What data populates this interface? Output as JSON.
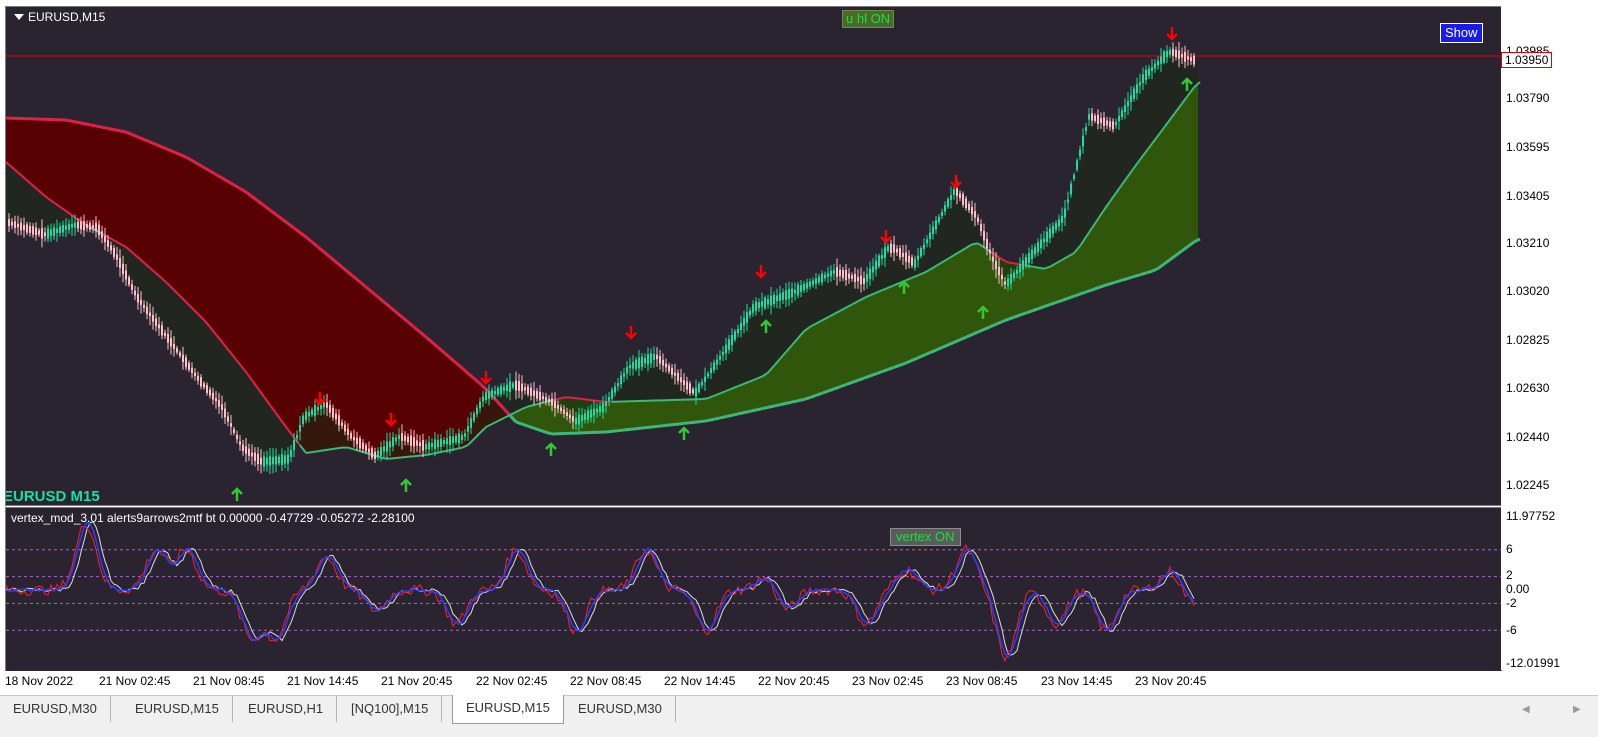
{
  "main_chart": {
    "title": "EURUSD,M15",
    "hl_button": "u hl ON",
    "show_button": "Show",
    "symbol_label": "EURUSD M15"
  },
  "sub_chart": {
    "title": "vertex_mod_3.01 alerts9arrows2mtf bt 0.00000 -0.47729 -0.05272 -2.28100",
    "vertex_button": "vertex ON"
  },
  "price_axis": {
    "top_label": "1.03985",
    "current_price": "1.03950",
    "labels": [
      "1.03790",
      "1.03595",
      "1.03405",
      "1.03210",
      "1.03020",
      "1.02825",
      "1.02630",
      "1.02440",
      "1.02245"
    ]
  },
  "sub_axis": {
    "labels": [
      "11.97752",
      "6",
      "2",
      "0.00",
      "-2",
      "-6",
      "-12.01991"
    ]
  },
  "time_axis": {
    "labels": [
      "18 Nov 2022",
      "21 Nov 02:45",
      "21 Nov 08:45",
      "21 Nov 14:45",
      "21 Nov 20:45",
      "22 Nov 02:45",
      "22 Nov 08:45",
      "22 Nov 14:45",
      "22 Nov 20:45",
      "23 Nov 02:45",
      "23 Nov 08:45",
      "23 Nov 14:45",
      "23 Nov 20:45"
    ]
  },
  "tabs": [
    "EURUSD,M30",
    "EURUSD,M15",
    "EURUSD,H1",
    "[NQ100],M15",
    "EURUSD,M15",
    "EURUSD,M30"
  ],
  "active_tab": 4,
  "icons": {
    "nav_left": "◀",
    "nav_right": "▶"
  },
  "colors": {
    "background": "#29242f",
    "bull_candle": "#19e0a0",
    "bear_candle": "#ffc0cb",
    "down_arrow": "#ff0000",
    "up_arrow": "#32c832",
    "cloud_bear": "#5a0000",
    "cloud_bull": "#2f5a0a",
    "price_line": "#e00000"
  }
}
